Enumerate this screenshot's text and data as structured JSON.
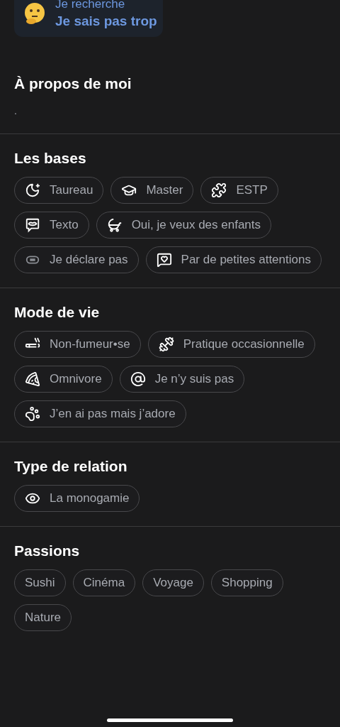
{
  "looking_for": {
    "label": "Je recherche",
    "value": "Je sais pas trop"
  },
  "sections": [
    {
      "kind": "text",
      "title": "À propos de moi",
      "text": "."
    },
    {
      "kind": "attributes",
      "title": "Les bases",
      "chips": [
        "Taureau",
        "Master",
        "ESTP",
        "Texto",
        "Oui, je veux des enfants",
        "Je déclare pas",
        "Par de petites attentions"
      ]
    },
    {
      "kind": "attributes",
      "title": "Mode de vie",
      "chips": [
        "Non-fumeur•se",
        "Pratique occasionnelle",
        "Omnivore",
        "Je n’y suis pas",
        "J’en ai pas mais j’adore"
      ]
    },
    {
      "kind": "attributes",
      "title": "Type de relation",
      "chips": [
        "La monogamie"
      ]
    },
    {
      "kind": "tags",
      "title": "Passions",
      "chips": [
        "Sushi",
        "Cinéma",
        "Voyage",
        "Shopping",
        "Nature"
      ]
    }
  ]
}
